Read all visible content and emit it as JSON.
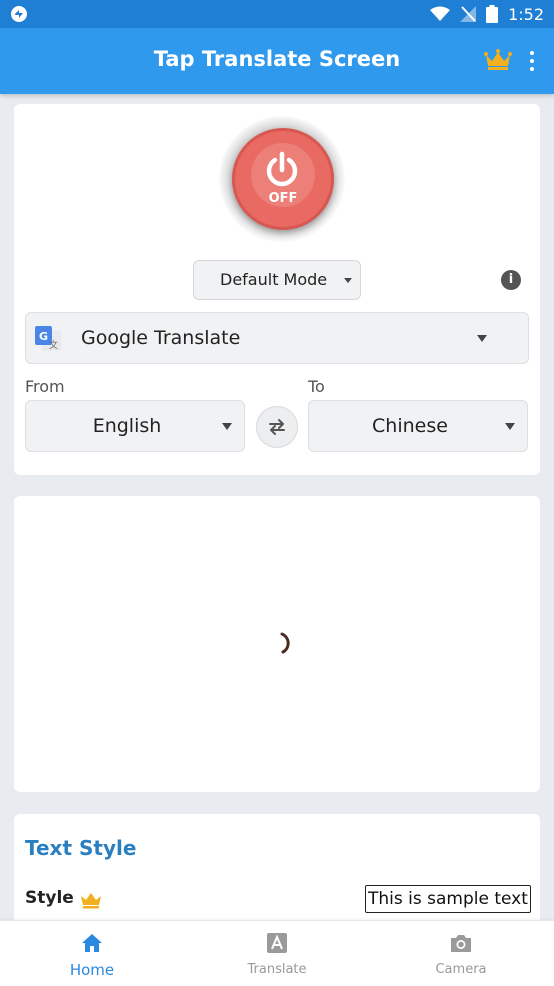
{
  "status_bar": {
    "time": "1:52"
  },
  "app_bar": {
    "title": "Tap Translate Screen"
  },
  "power": {
    "state_label": "OFF"
  },
  "mode": {
    "selected": "Default Mode"
  },
  "engine": {
    "selected": "Google Translate"
  },
  "languages": {
    "from_label": "From",
    "to_label": "To",
    "from": "English",
    "to": "Chinese"
  },
  "text_style": {
    "title": "Text Style",
    "style_label": "Style",
    "sample": "This is sample text"
  },
  "bottom_nav": {
    "items": [
      {
        "label": "Home",
        "icon": "home-icon",
        "active": true
      },
      {
        "label": "Translate",
        "icon": "translate-icon",
        "active": false
      },
      {
        "label": "Camera",
        "icon": "camera-icon",
        "active": false
      }
    ]
  },
  "colors": {
    "primary": "#2f99ee",
    "status_bar": "#1f7fd4",
    "power_off": "#e86a63",
    "accent_text": "#2a7fc0",
    "crown": "#f2b01e",
    "nav_active": "#2a8ae0"
  }
}
